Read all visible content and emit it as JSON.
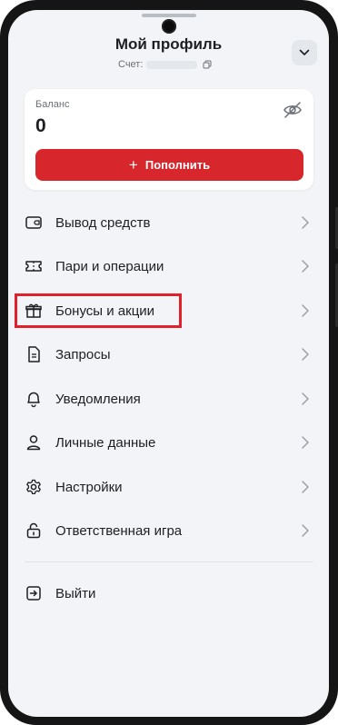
{
  "header": {
    "title": "Мой профиль",
    "account_label": "Счет:"
  },
  "balance": {
    "label": "Баланс",
    "value": "0",
    "topup_label": "Пополнить"
  },
  "menu": [
    {
      "label": "Вывод средств",
      "icon": "wallet-icon"
    },
    {
      "label": "Пари и операции",
      "icon": "ticket-icon"
    },
    {
      "label": "Бонусы и акции",
      "icon": "gift-icon"
    },
    {
      "label": "Запросы",
      "icon": "document-icon"
    },
    {
      "label": "Уведомления",
      "icon": "bell-icon"
    },
    {
      "label": "Личные данные",
      "icon": "user-icon"
    },
    {
      "label": "Настройки",
      "icon": "gear-icon"
    },
    {
      "label": "Ответственная игра",
      "icon": "lock-icon"
    }
  ],
  "logout": {
    "label": "Выйти",
    "icon": "logout-icon"
  },
  "colors": {
    "accent": "#d8262d",
    "highlight": "#e0202a",
    "background": "#f2f4f7",
    "text": "#1d1f24"
  }
}
